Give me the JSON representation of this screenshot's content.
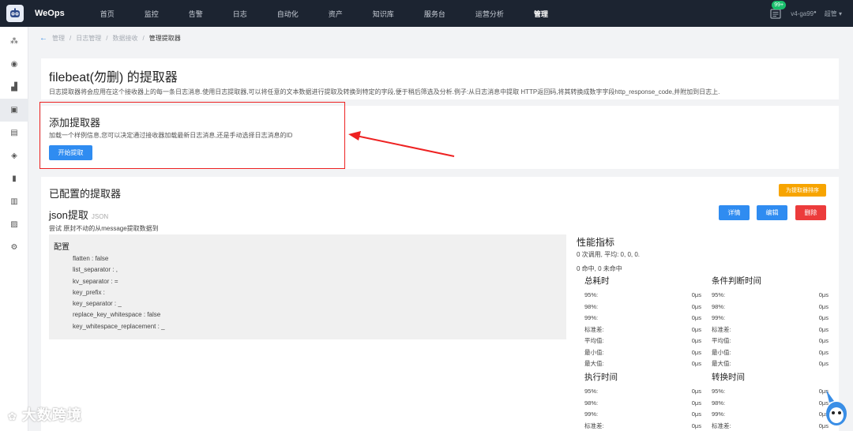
{
  "app": {
    "brand": "WeOps"
  },
  "nav": {
    "items": [
      "首页",
      "监控",
      "告警",
      "日志",
      "自动化",
      "资产",
      "知识库",
      "服务台",
      "运营分析",
      "管理"
    ],
    "active_index": 9
  },
  "topbar": {
    "badge": "99+",
    "version": "v4-ga99",
    "user": "超管"
  },
  "sidebar": {
    "icons": [
      "topology-icon",
      "camera-icon",
      "chart-icon",
      "log-icon",
      "briefcase-icon",
      "layers-icon",
      "document-icon",
      "clipboard-icon",
      "image-icon",
      "settings-icon"
    ],
    "active_index": 3
  },
  "breadcrumb": {
    "items": [
      "管理",
      "日志管理",
      "数据接收"
    ],
    "current": "管理提取器"
  },
  "header": {
    "title": "filebeat(勿删) 的提取器",
    "description": "日志提取器将会应用在这个接收器上的每一条日志消息.使用日志提取器,可以将任意的文本数据进行提取及转换到特定的字段,便于稍后筛选及分析.例子:从日志消息中提取 HTTP返回码,将其转换成数字字段http_response_code,并附加到日志上."
  },
  "add": {
    "title": "添加提取器",
    "description": "加载一个样例信息,您可以决定通过接收器加载最新日志消息,还是手动选择日志消息的ID",
    "button": "开始提取"
  },
  "configured": {
    "title": "已配置的提取器",
    "sort_button": "为提取器排序",
    "extractor": {
      "name": "json提取",
      "type": "JSON",
      "description": "尝试 原封不动的从message提取数据到",
      "buttons": {
        "details": "详情",
        "edit": "编辑",
        "delete": "删除"
      },
      "config_title": "配置",
      "config": [
        "flatten : false",
        "list_separator : ,",
        "kv_separator : =",
        "key_prefix :",
        "key_separator : _",
        "replace_key_whitespace : false",
        "key_whitespace_replacement : _"
      ]
    },
    "perf": {
      "title": "性能指标",
      "line1": "0 次调用, 平均: 0, 0, 0.",
      "line2": "0 命中, 0 未命中",
      "blocks": [
        {
          "title": "总耗时",
          "rows": [
            [
              "95%:",
              "0μs"
            ],
            [
              "98%:",
              "0μs"
            ],
            [
              "99%:",
              "0μs"
            ],
            [
              "标准差:",
              "0μs"
            ],
            [
              "平均值:",
              "0μs"
            ],
            [
              "最小值:",
              "0μs"
            ],
            [
              "最大值:",
              "0μs"
            ]
          ]
        },
        {
          "title": "条件判断时间",
          "rows": [
            [
              "95%:",
              "0μs"
            ],
            [
              "98%:",
              "0μs"
            ],
            [
              "99%:",
              "0μs"
            ],
            [
              "标准差:",
              "0μs"
            ],
            [
              "平均值:",
              "0μs"
            ],
            [
              "最小值:",
              "0μs"
            ],
            [
              "最大值:",
              "0μs"
            ]
          ]
        },
        {
          "title": "执行时间",
          "rows": [
            [
              "95%:",
              "0μs"
            ],
            [
              "98%:",
              "0μs"
            ],
            [
              "99%:",
              "0μs"
            ],
            [
              "标准差:",
              "0μs"
            ]
          ]
        },
        {
          "title": "转换时间",
          "rows": [
            [
              "95%:",
              "0μs"
            ],
            [
              "98%:",
              "0μs"
            ],
            [
              "99%:",
              "0μs"
            ],
            [
              "标准差:",
              "0μs"
            ]
          ]
        }
      ]
    }
  },
  "watermark": "大数跨境",
  "colors": {
    "topbar": "#1c2431",
    "primary": "#2f8cf1",
    "orange": "#f7a400",
    "red": "#ec3b3b",
    "highlight": "#e22222"
  }
}
